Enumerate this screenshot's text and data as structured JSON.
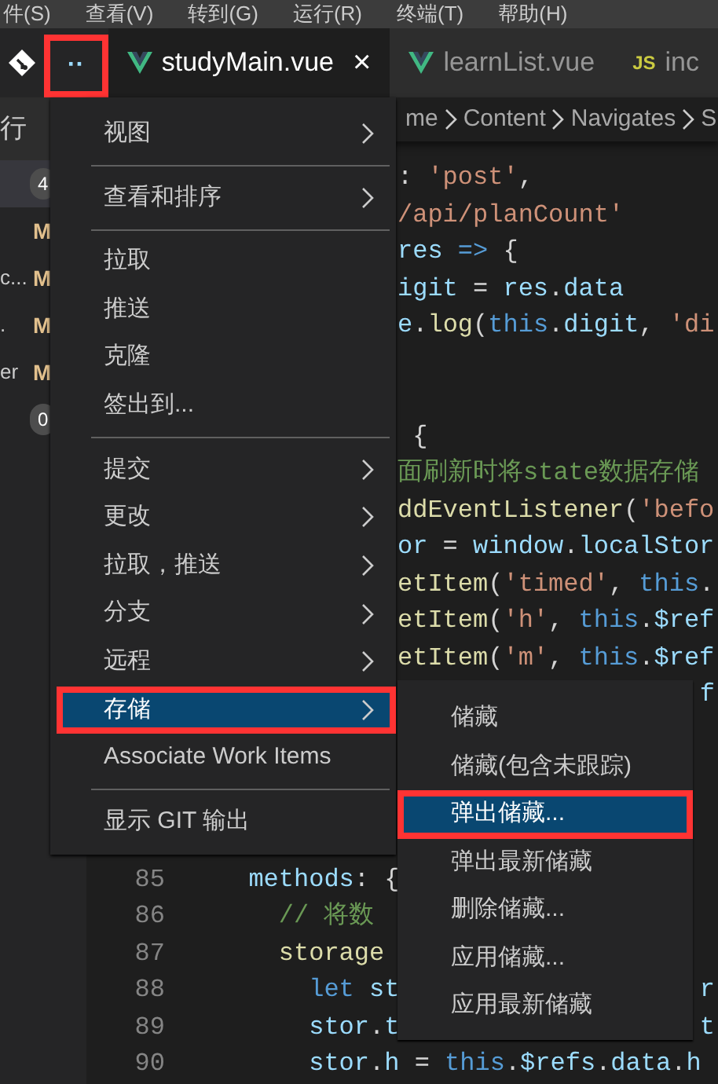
{
  "menu_bar": [
    "件(S)",
    "查看(V)",
    "转到(G)",
    "运行(R)",
    "终端(T)",
    "帮助(H)"
  ],
  "more_button": {
    "label": "··",
    "annotated": true
  },
  "tabs": [
    {
      "label": "studyMain.vue",
      "kind": "vue",
      "selected": true,
      "close": "×"
    },
    {
      "label": "learnList.vue",
      "kind": "vue",
      "selected": false
    },
    {
      "label": "inc",
      "kind": "js",
      "icon_text": "JS",
      "selected": false
    }
  ],
  "breadcrumb": [
    "me",
    "Content",
    "Navigates",
    "S"
  ],
  "sidebar": {
    "header": "行",
    "rows": [
      {
        "badge": "4",
        "selected": true
      },
      {
        "status": "M",
        "selected": false
      },
      {
        "label": "c...",
        "status": "M",
        "selected": false
      },
      {
        "label": ".",
        "status": "M",
        "selected": false
      },
      {
        "label": "er",
        "status": "M",
        "selected": false
      },
      {
        "badge": "0",
        "selected": false
      }
    ]
  },
  "context_menu": {
    "items": [
      {
        "kind": "item",
        "label": "视图",
        "submenu": true,
        "selected": false
      },
      {
        "kind": "separator"
      },
      {
        "kind": "item",
        "label": "查看和排序",
        "submenu": true,
        "selected": false
      },
      {
        "kind": "separator"
      },
      {
        "kind": "item",
        "label": "拉取",
        "submenu": false,
        "selected": false
      },
      {
        "kind": "item",
        "label": "推送",
        "submenu": false,
        "selected": false
      },
      {
        "kind": "item",
        "label": "克隆",
        "submenu": false,
        "selected": false
      },
      {
        "kind": "item",
        "label": "签出到...",
        "submenu": false,
        "selected": false
      },
      {
        "kind": "separator"
      },
      {
        "kind": "item",
        "label": "提交",
        "submenu": true,
        "selected": false
      },
      {
        "kind": "item",
        "label": "更改",
        "submenu": true,
        "selected": false
      },
      {
        "kind": "item",
        "label": "拉取，推送",
        "submenu": true,
        "selected": false
      },
      {
        "kind": "item",
        "label": "分支",
        "submenu": true,
        "selected": false
      },
      {
        "kind": "item",
        "label": "远程",
        "submenu": true,
        "selected": false
      },
      {
        "kind": "item",
        "label": "存储",
        "submenu": true,
        "selected": true,
        "annotated": true
      },
      {
        "kind": "item",
        "label": "Associate Work Items",
        "submenu": false,
        "selected": false
      },
      {
        "kind": "separator"
      },
      {
        "kind": "item",
        "label": "显示 GIT 输出",
        "submenu": false,
        "selected": false
      }
    ]
  },
  "submenu": {
    "items": [
      {
        "label": "储藏",
        "selected": false
      },
      {
        "label": "储藏(包含未跟踪)",
        "selected": false
      },
      {
        "label": "弹出储藏...",
        "selected": true,
        "annotated": true
      },
      {
        "label": "弹出最新储藏",
        "selected": false
      },
      {
        "label": "删除储藏...",
        "selected": false
      },
      {
        "label": "应用储藏...",
        "selected": false
      },
      {
        "label": "应用最新储藏",
        "selected": false
      }
    ]
  },
  "editor": {
    "lines": [
      {
        "kind": "clipped",
        "segments": [
          {
            "kind": "plain",
            "text": ": "
          },
          {
            "kind": "string",
            "text": "'post'"
          },
          {
            "kind": "plain",
            "text": ","
          }
        ]
      },
      {
        "kind": "clipped",
        "segments": [
          {
            "kind": "string",
            "text": "/api/planCount'"
          }
        ]
      },
      {
        "kind": "clipped",
        "segments": [
          {
            "kind": "variable",
            "text": "res"
          },
          {
            "kind": "keyword",
            "text": " => "
          },
          {
            "kind": "plain",
            "text": "{"
          }
        ]
      },
      {
        "kind": "clipped",
        "segments": [
          {
            "kind": "variable",
            "text": "igit"
          },
          {
            "kind": "plain",
            "text": " = "
          },
          {
            "kind": "variable",
            "text": "res"
          },
          {
            "kind": "plain",
            "text": "."
          },
          {
            "kind": "variable",
            "text": "data"
          }
        ]
      },
      {
        "kind": "clipped",
        "segments": [
          {
            "kind": "variable",
            "text": "e"
          },
          {
            "kind": "plain",
            "text": "."
          },
          {
            "kind": "function",
            "text": "log"
          },
          {
            "kind": "plain",
            "text": "("
          },
          {
            "kind": "keyword",
            "text": "this"
          },
          {
            "kind": "plain",
            "text": "."
          },
          {
            "kind": "variable",
            "text": "digit"
          },
          {
            "kind": "plain",
            "text": ", "
          },
          {
            "kind": "string",
            "text": "'di"
          }
        ]
      },
      {
        "kind": "blank"
      },
      {
        "kind": "blank"
      },
      {
        "kind": "clipped",
        "segments": [
          {
            "kind": "plain",
            "text": " {"
          }
        ]
      },
      {
        "kind": "clipped",
        "segments": [
          {
            "kind": "comment",
            "text": "面刷新时将state数据存储"
          }
        ]
      },
      {
        "kind": "clipped",
        "segments": [
          {
            "kind": "function",
            "text": "ddEventListener"
          },
          {
            "kind": "plain",
            "text": "("
          },
          {
            "kind": "string",
            "text": "'befo"
          }
        ]
      },
      {
        "kind": "clipped",
        "segments": [
          {
            "kind": "variable",
            "text": "or"
          },
          {
            "kind": "plain",
            "text": " = "
          },
          {
            "kind": "variable",
            "text": "window"
          },
          {
            "kind": "plain",
            "text": "."
          },
          {
            "kind": "variable",
            "text": "localStor"
          }
        ]
      },
      {
        "kind": "clipped",
        "segments": [
          {
            "kind": "function",
            "text": "etItem"
          },
          {
            "kind": "plain",
            "text": "("
          },
          {
            "kind": "string",
            "text": "'timed'"
          },
          {
            "kind": "plain",
            "text": ", "
          },
          {
            "kind": "keyword",
            "text": "this"
          },
          {
            "kind": "plain",
            "text": "."
          }
        ]
      },
      {
        "kind": "clipped",
        "segments": [
          {
            "kind": "function",
            "text": "etItem"
          },
          {
            "kind": "plain",
            "text": "("
          },
          {
            "kind": "string",
            "text": "'h'"
          },
          {
            "kind": "plain",
            "text": ", "
          },
          {
            "kind": "keyword",
            "text": "this"
          },
          {
            "kind": "plain",
            "text": "."
          },
          {
            "kind": "variable",
            "text": "$ref"
          }
        ]
      },
      {
        "kind": "clipped",
        "segments": [
          {
            "kind": "function",
            "text": "etItem"
          },
          {
            "kind": "plain",
            "text": "("
          },
          {
            "kind": "string",
            "text": "'m'"
          },
          {
            "kind": "plain",
            "text": ", "
          },
          {
            "kind": "keyword",
            "text": "this"
          },
          {
            "kind": "plain",
            "text": "."
          },
          {
            "kind": "variable",
            "text": "$ref"
          }
        ]
      },
      {
        "kind": "clipped",
        "tail": [
          {
            "kind": "variable",
            "text": "f"
          }
        ]
      },
      {
        "kind": "blank"
      },
      {
        "kind": "blank"
      },
      {
        "kind": "blank"
      },
      {
        "kind": "blank"
      },
      {
        "kind": "full",
        "number": "85",
        "segments": [
          {
            "kind": "variable",
            "text": "methods"
          },
          {
            "kind": "plain",
            "text": ": {"
          }
        ],
        "children": [
          {
            "kind": "full",
            "number": "86",
            "segments": [
              {
                "kind": "comment",
                "text": "// 将数"
              }
            ]
          },
          {
            "kind": "full",
            "number": "87",
            "segments": [
              {
                "kind": "function",
                "text": "storage"
              }
            ],
            "children": [
              {
                "kind": "full",
                "number": "88",
                "segments": [
                  {
                    "kind": "keyword",
                    "text": "let "
                  },
                  {
                    "kind": "variable",
                    "text": "st"
                  }
                ],
                "tail": [
                  {
                    "kind": "variable",
                    "text": "r"
                  }
                ]
              },
              {
                "kind": "full",
                "number": "89",
                "segments": [
                  {
                    "kind": "variable",
                    "text": "stor"
                  },
                  {
                    "kind": "plain",
                    "text": "."
                  },
                  {
                    "kind": "variable",
                    "text": "t"
                  }
                ],
                "tail": [
                  {
                    "kind": "variable",
                    "text": "t"
                  }
                ]
              },
              {
                "kind": "full",
                "number": "90",
                "segments": [
                  {
                    "kind": "variable",
                    "text": "stor"
                  },
                  {
                    "kind": "plain",
                    "text": "."
                  },
                  {
                    "kind": "variable",
                    "text": "h"
                  },
                  {
                    "kind": "plain",
                    "text": " = "
                  },
                  {
                    "kind": "keyword",
                    "text": "this"
                  },
                  {
                    "kind": "plain",
                    "text": "."
                  },
                  {
                    "kind": "variable",
                    "text": "$refs"
                  },
                  {
                    "kind": "plain",
                    "text": "."
                  },
                  {
                    "kind": "variable",
                    "text": "data"
                  },
                  {
                    "kind": "plain",
                    "text": "."
                  },
                  {
                    "kind": "variable",
                    "text": "h"
                  }
                ]
              }
            ]
          }
        ]
      }
    ]
  }
}
